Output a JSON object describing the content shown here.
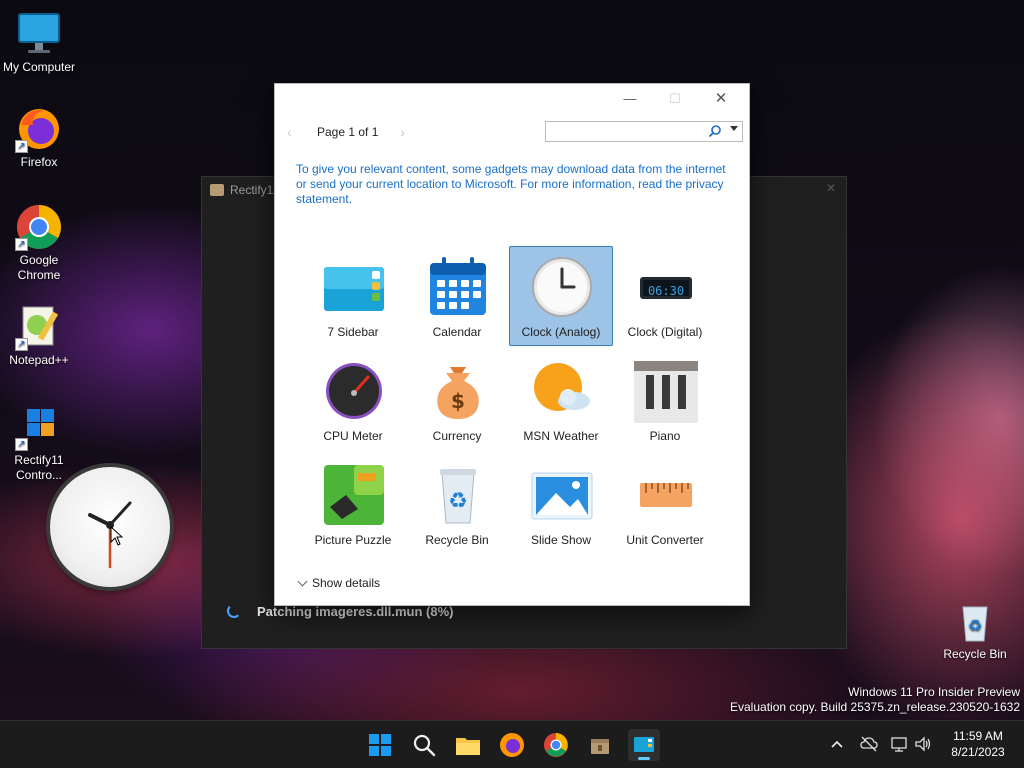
{
  "desktop": {
    "icons": [
      {
        "label": "My Computer"
      },
      {
        "label": "Firefox"
      },
      {
        "label": "Google Chrome"
      },
      {
        "label": "Notepad++"
      },
      {
        "label": "Rectify11 Contro..."
      },
      {
        "label": "Recycle Bin"
      }
    ],
    "watermark": {
      "line1": "Windows 11 Pro Insider Preview",
      "line2": "Evaluation copy. Build 25375.zn_release.230520-1632"
    }
  },
  "background_window": {
    "title": "Rectify11",
    "status": "Patching imageres.dll.mun (8%)"
  },
  "gadget_gallery": {
    "page_label": "Page 1 of 1",
    "search_placeholder": "",
    "info_text": "To give you relevant content, some gadgets may download data from the internet or send your current location to Microsoft. For more information, read the privacy statement.",
    "gadgets": [
      {
        "label": "7 Sidebar",
        "icon": "sidebar-icon",
        "selected": false
      },
      {
        "label": "Calendar",
        "icon": "calendar-icon",
        "selected": false
      },
      {
        "label": "Clock (Analog)",
        "icon": "analog-clock-icon",
        "selected": true
      },
      {
        "label": "Clock (Digital)",
        "icon": "digital-clock-icon",
        "selected": false,
        "display": "06:30"
      },
      {
        "label": "CPU Meter",
        "icon": "cpu-meter-icon",
        "selected": false
      },
      {
        "label": "Currency",
        "icon": "currency-icon",
        "selected": false
      },
      {
        "label": "MSN Weather",
        "icon": "weather-icon",
        "selected": false
      },
      {
        "label": "Piano",
        "icon": "piano-icon",
        "selected": false
      },
      {
        "label": "Picture Puzzle",
        "icon": "puzzle-icon",
        "selected": false
      },
      {
        "label": "Recycle Bin",
        "icon": "recycle-bin-icon",
        "selected": false
      },
      {
        "label": "Slide Show",
        "icon": "slideshow-icon",
        "selected": false
      },
      {
        "label": "Unit Converter",
        "icon": "ruler-icon",
        "selected": false
      }
    ],
    "show_details": "Show details",
    "selection_color": "#9dc3e6"
  },
  "taskbar": {
    "time": "11:59 AM",
    "date": "8/21/2023",
    "accent": "#60cdff"
  }
}
